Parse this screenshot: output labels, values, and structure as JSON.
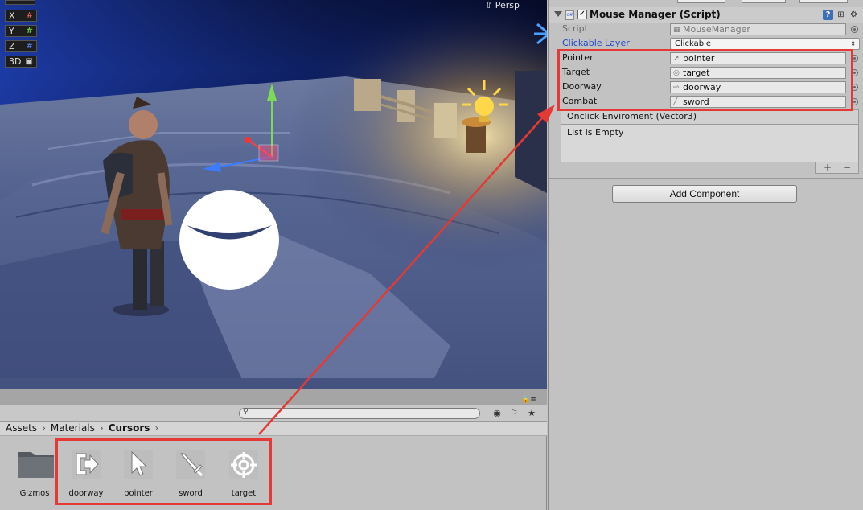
{
  "scene": {
    "view_mode": "Persp",
    "axes": [
      {
        "label": "X",
        "color": "#ff5a5a"
      },
      {
        "label": "Y",
        "color": "#8cff5a"
      },
      {
        "label": "Z",
        "color": "#5a8cff"
      },
      {
        "label": "3D",
        "color": "#dddddd"
      }
    ]
  },
  "project": {
    "breadcrumb": [
      "Assets",
      "Materials",
      "Cursors"
    ],
    "items": [
      {
        "label": "Gizmos",
        "icon": "folder-icon"
      },
      {
        "label": "doorway",
        "icon": "doorway-cursor-icon"
      },
      {
        "label": "pointer",
        "icon": "pointer-cursor-icon"
      },
      {
        "label": "sword",
        "icon": "sword-cursor-icon"
      },
      {
        "label": "target",
        "icon": "target-cursor-icon"
      }
    ]
  },
  "inspector": {
    "component_title": "Mouse Manager (Script)",
    "enabled": true,
    "script": {
      "label": "Script",
      "value": "MouseManager"
    },
    "clickable_layer": {
      "label": "Clickable Layer",
      "value": "Clickable"
    },
    "fields": [
      {
        "label": "Pointer",
        "value": "pointer"
      },
      {
        "label": "Target",
        "value": "target"
      },
      {
        "label": "Doorway",
        "value": "doorway"
      },
      {
        "label": "Combat",
        "value": "sword"
      }
    ],
    "event_list": {
      "header": "Onclick Enviroment (Vector3)",
      "empty_text": "List is Empty",
      "add": "+",
      "remove": "−"
    },
    "add_component_label": "Add Component"
  },
  "colors": {
    "highlight": "#e53935",
    "link_blue": "#1c47c8"
  }
}
